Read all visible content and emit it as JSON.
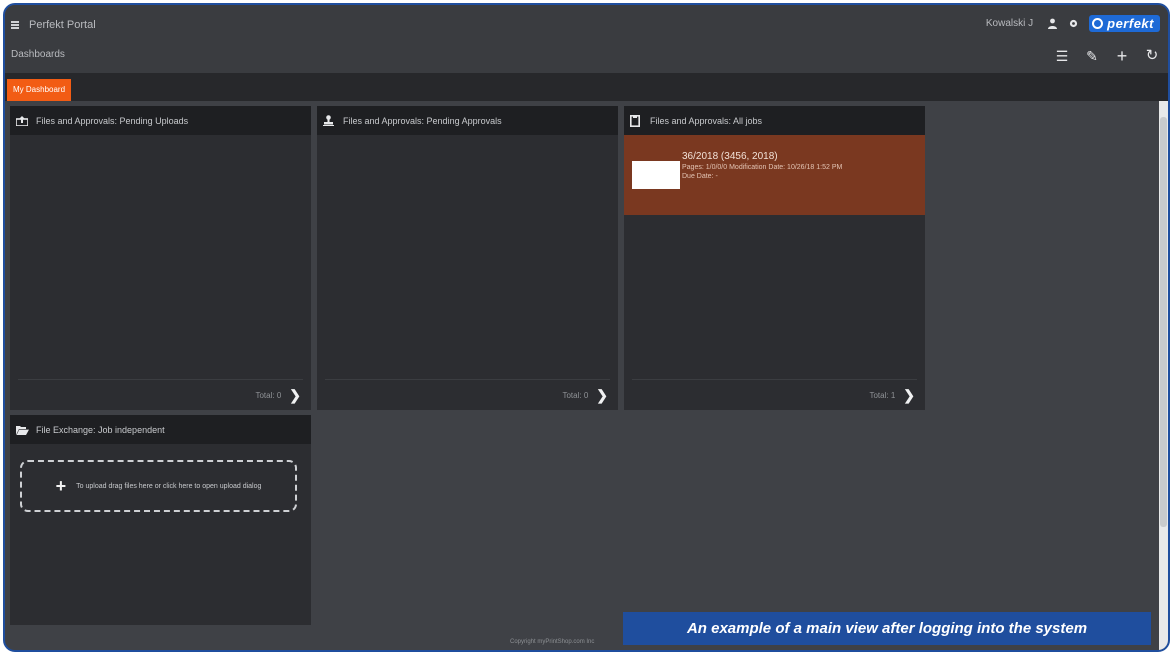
{
  "header": {
    "app_title": "Perfekt Portal",
    "breadcrumb": "Dashboards",
    "user_name": "Kowalski J",
    "logo_text": "perfekt"
  },
  "toolbar": {
    "tools": [
      {
        "icon": "sort-icon",
        "glyph": "☰"
      },
      {
        "icon": "pencil-icon",
        "glyph": "✎"
      },
      {
        "icon": "plus-icon",
        "glyph": "+"
      },
      {
        "icon": "refresh-icon",
        "glyph": "↻"
      }
    ]
  },
  "tabs": [
    {
      "label": "My Dashboard",
      "active": true
    }
  ],
  "widgets": {
    "pending_uploads": {
      "title": "Files and Approvals: Pending Uploads",
      "icon": "upload-icon",
      "total": "Total: 0"
    },
    "pending_approvals": {
      "title": "Files and Approvals: Pending Approvals",
      "icon": "approval-stamp-icon",
      "total": "Total: 0"
    },
    "all_jobs": {
      "title": "Files and Approvals: All jobs",
      "icon": "document-icon",
      "total": "Total: 1",
      "jobs": [
        {
          "title": "36/2018 (3456, 2018)",
          "meta": "Pages: 1/0/0/0  Modification Date: 10/26/18 1:52 PM",
          "due": "Due Date: -"
        }
      ]
    },
    "file_exchange": {
      "title": "File Exchange: Job independent",
      "icon": "folder-open-icon",
      "dropzone_text": "To upload drag files here or click here to open upload dialog"
    }
  },
  "footer": {
    "copyright": "Copyright myPrintShop.com Inc"
  },
  "caption": "An example of a main view after logging into the system",
  "colors": {
    "accent": "#f25c14",
    "job_card": "#7a3820",
    "caption_bg": "#1f4e9e"
  }
}
